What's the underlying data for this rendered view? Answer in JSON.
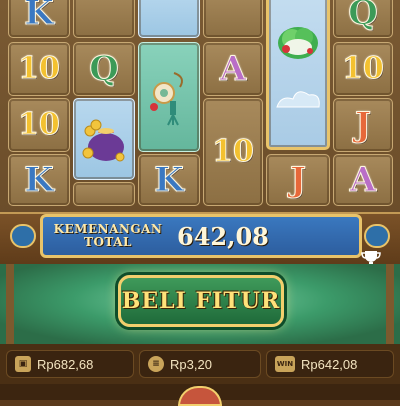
{
  "reels": {
    "symbols": [
      {
        "id": "r1c1",
        "glyph": "K",
        "kind": "K"
      },
      {
        "id": "r1c5",
        "glyph": "Q",
        "kind": "Q"
      },
      {
        "id": "r2c1",
        "glyph": "10",
        "kind": "10"
      },
      {
        "id": "r2c2",
        "glyph": "Q",
        "kind": "Q"
      },
      {
        "id": "r2c4",
        "glyph": "A",
        "kind": "A"
      },
      {
        "id": "r2c6",
        "glyph": "10",
        "kind": "10"
      },
      {
        "id": "r3c1",
        "glyph": "10",
        "kind": "10"
      },
      {
        "id": "r3c6",
        "glyph": "J",
        "kind": "J"
      },
      {
        "id": "r4c1",
        "glyph": "K",
        "kind": "K"
      },
      {
        "id": "r4c3",
        "glyph": "K",
        "kind": "K"
      },
      {
        "id": "r3c4",
        "glyph": "10",
        "kind": "10"
      },
      {
        "id": "r4c5",
        "glyph": "J",
        "kind": "J"
      },
      {
        "id": "r4c6",
        "glyph": "A",
        "kind": "A"
      }
    ],
    "special_icons": [
      "cabbage-icon",
      "money-bag-icon",
      "jade-pendant-icon"
    ]
  },
  "win_banner": {
    "label_line1": "KEMENANGAN",
    "label_line2": "TOTAL",
    "value": "642,08"
  },
  "buy_feature": {
    "label": "BELI FITUR"
  },
  "stats": {
    "balance": "Rp682,68",
    "bet": "Rp3,20",
    "win": "Rp642,08"
  },
  "colors": {
    "accent_gold": "#e8c36a",
    "banner_blue": "#3a78bf",
    "feature_green": "#3c9b6a"
  }
}
